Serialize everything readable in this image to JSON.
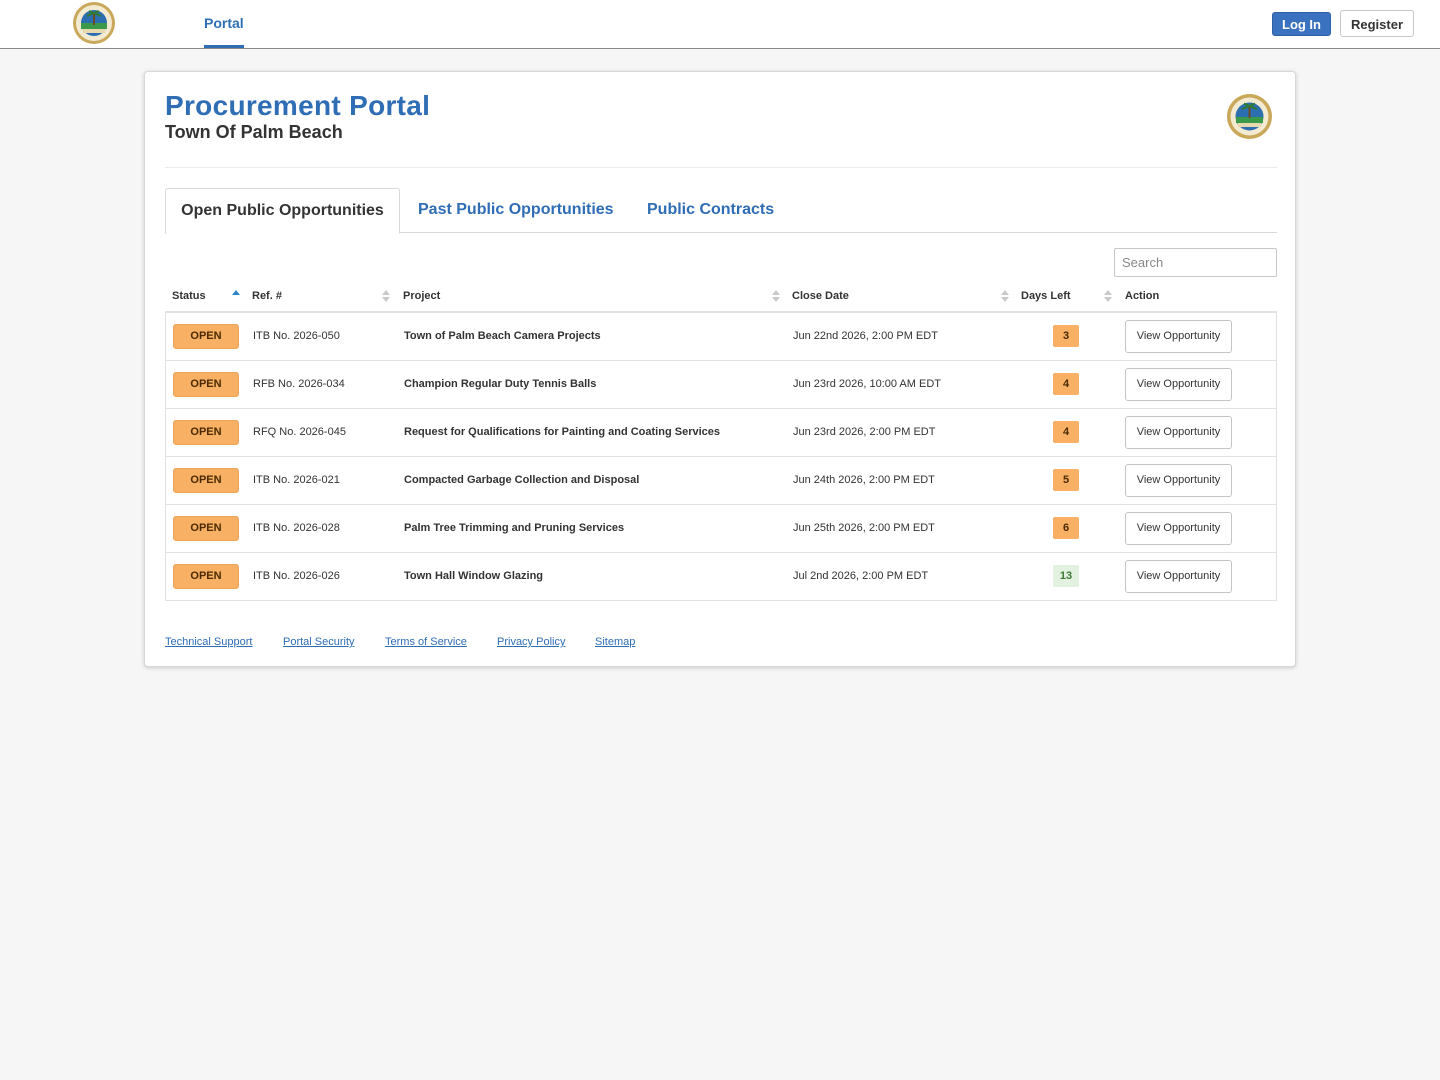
{
  "header": {
    "nav_portal": "Portal",
    "login_label": "Log In",
    "register_label": "Register"
  },
  "card": {
    "title": "Procurement Portal",
    "subtitle": "Town Of Palm Beach"
  },
  "tabs": [
    {
      "label": "Open Public Opportunities",
      "active": true
    },
    {
      "label": "Past Public Opportunities",
      "active": false
    },
    {
      "label": "Public Contracts",
      "active": false
    }
  ],
  "search": {
    "placeholder": "Search",
    "value": ""
  },
  "table": {
    "columns": [
      "Status",
      "Ref. #",
      "Project",
      "Close Date",
      "Days Left",
      "Action"
    ],
    "sorted_column": "Status",
    "rows": [
      {
        "status": "OPEN",
        "ref": "ITB No. 2026-050",
        "project": "Town of Palm Beach Camera Projects",
        "close_date": "Jun 22nd 2026, 2:00 PM EDT",
        "days_left": "3",
        "days_level": "warn",
        "action": "View Opportunity"
      },
      {
        "status": "OPEN",
        "ref": "RFB No. 2026-034",
        "project": "Champion Regular Duty Tennis Balls",
        "close_date": "Jun 23rd 2026, 10:00 AM EDT",
        "days_left": "4",
        "days_level": "warn",
        "action": "View Opportunity"
      },
      {
        "status": "OPEN",
        "ref": "RFQ No. 2026-045",
        "project": "Request for Qualifications for Painting and Coating Services",
        "close_date": "Jun 23rd 2026, 2:00 PM EDT",
        "days_left": "4",
        "days_level": "warn",
        "action": "View Opportunity"
      },
      {
        "status": "OPEN",
        "ref": "ITB No. 2026-021",
        "project": "Compacted Garbage Collection and Disposal",
        "close_date": "Jun 24th 2026, 2:00 PM EDT",
        "days_left": "5",
        "days_level": "warn",
        "action": "View Opportunity"
      },
      {
        "status": "OPEN",
        "ref": "ITB No. 2026-028",
        "project": "Palm Tree Trimming and Pruning Services",
        "close_date": "Jun 25th 2026, 2:00 PM EDT",
        "days_left": "6",
        "days_level": "warn",
        "action": "View Opportunity"
      },
      {
        "status": "OPEN",
        "ref": "ITB No. 2026-026",
        "project": "Town Hall Window Glazing",
        "close_date": "Jul 2nd 2026, 2:00 PM EDT",
        "days_left": "13",
        "days_level": "ok",
        "action": "View Opportunity"
      }
    ]
  },
  "footer_links": [
    "Technical Support",
    "Portal Security",
    "Terms of Service",
    "Privacy Policy",
    "Sitemap"
  ],
  "colors": {
    "accent": "#2f6db5",
    "status_open": "#f7b064",
    "days_ok": "#e3f1e0"
  }
}
